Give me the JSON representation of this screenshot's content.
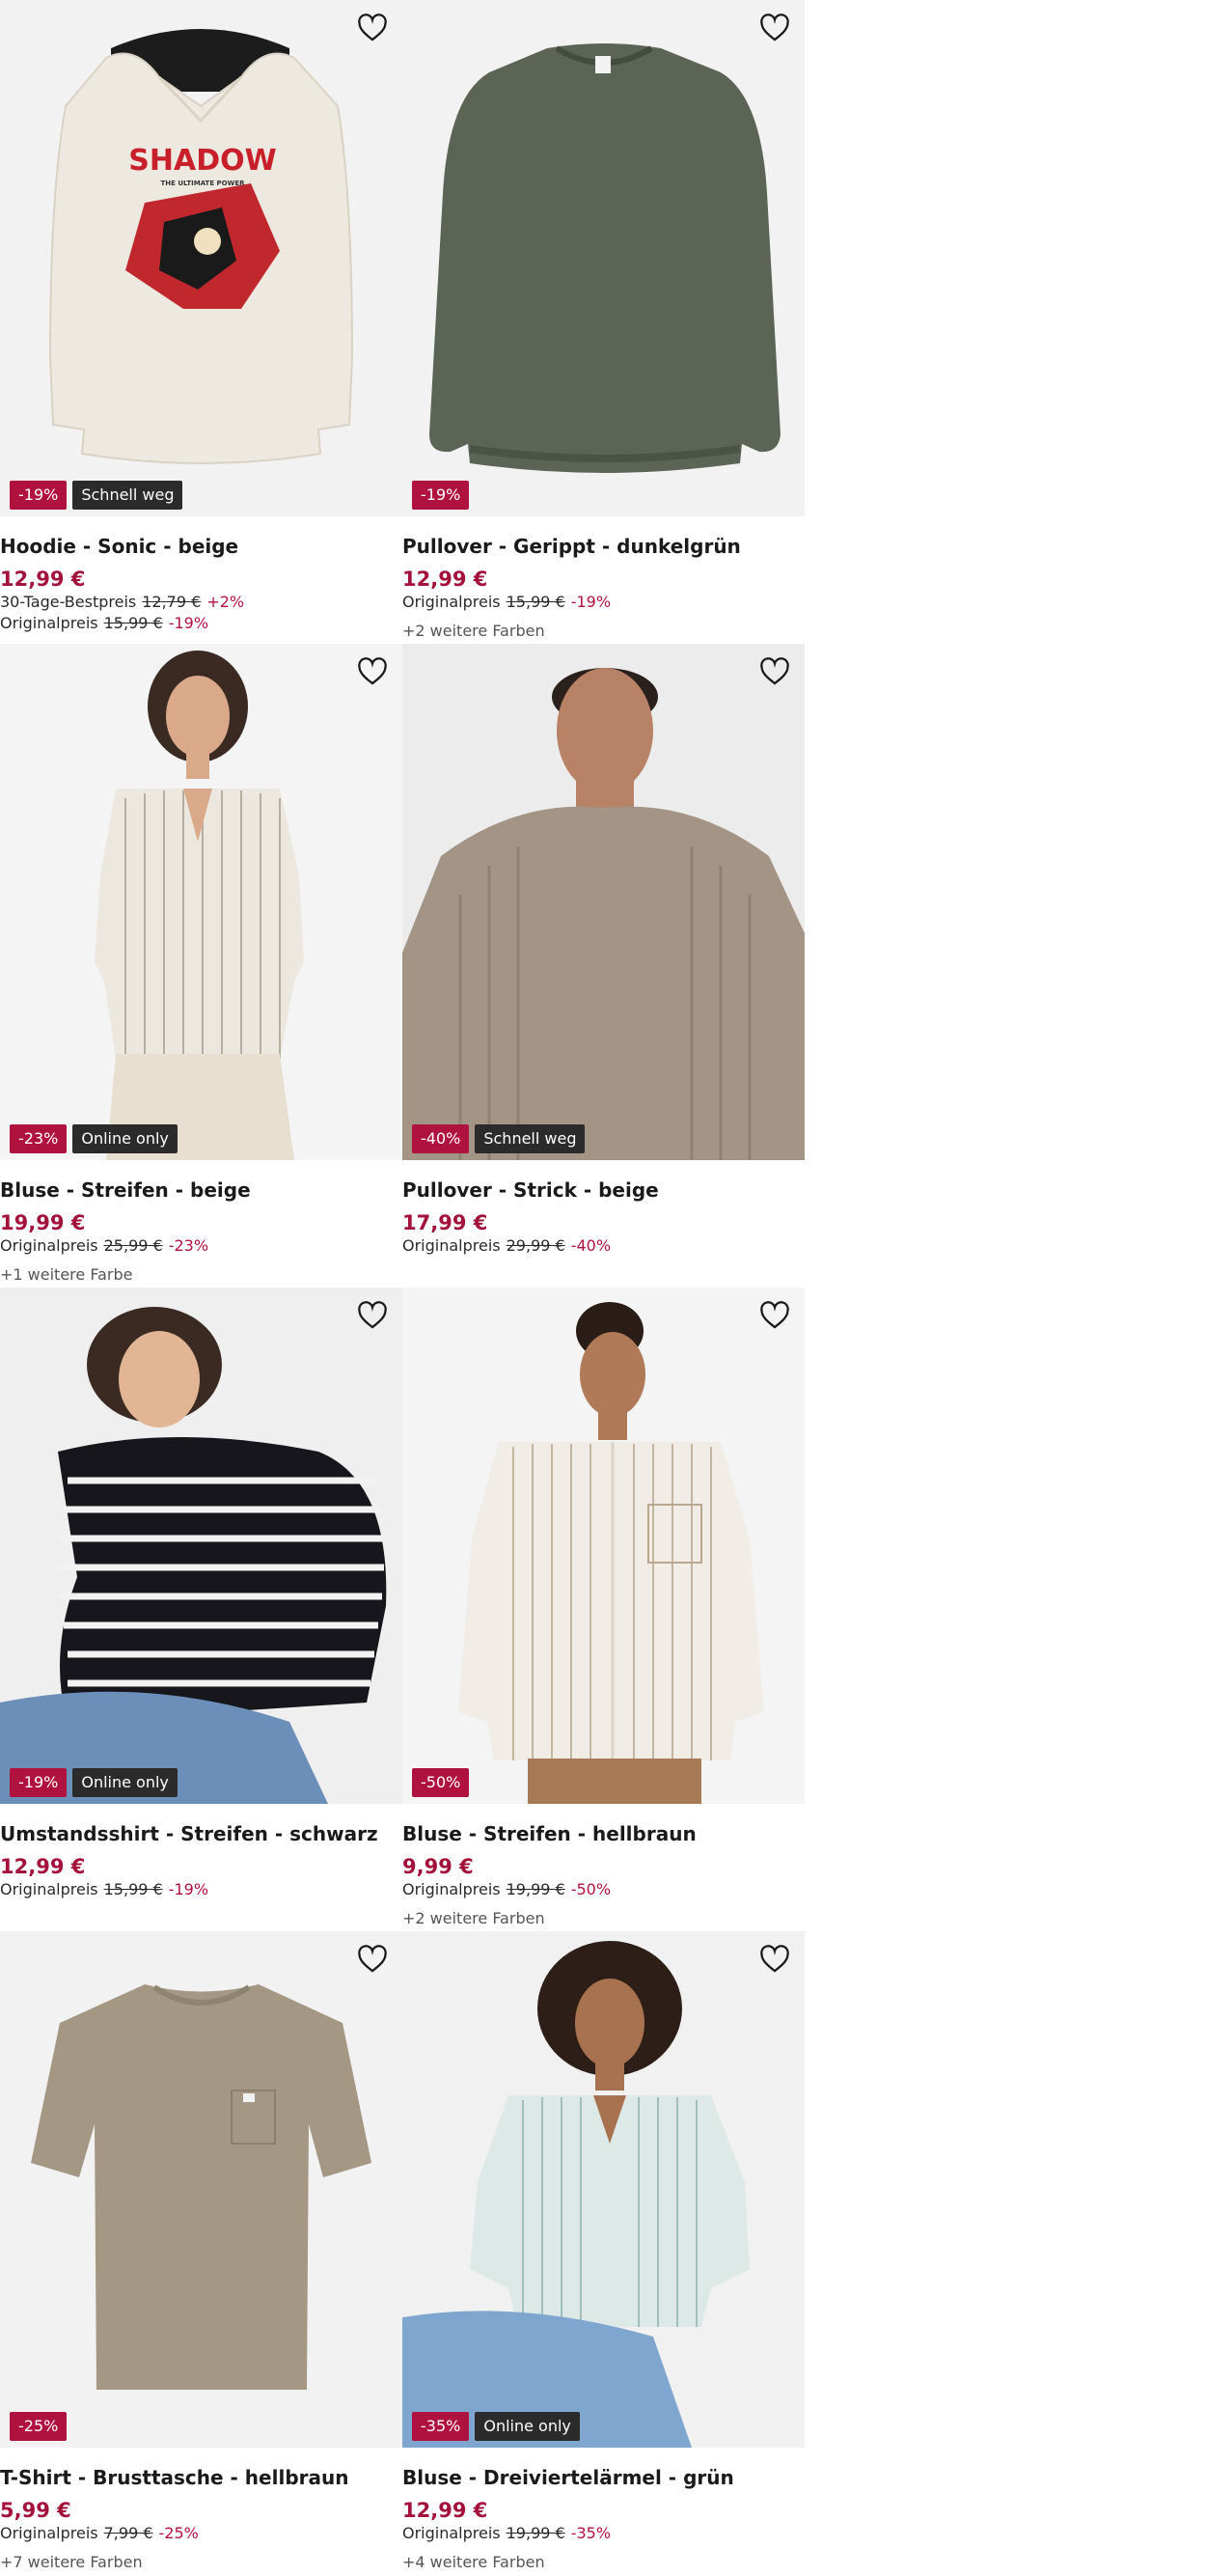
{
  "products": [
    {
      "name": "Hoodie - Sonic - beige",
      "price": "12,99 €",
      "badges": {
        "discount": "-19%",
        "tag": "Schnell weg"
      },
      "lowest30": {
        "label": "30-Tage-Bestpreis",
        "value": "12,79 €",
        "pct": "+2%"
      },
      "original": {
        "label": "Originalpreis",
        "value": "15,99 €",
        "pct": "-19%"
      },
      "colors": "",
      "print_title": "SHADOW",
      "print_sub": "THE ULTIMATE POWER",
      "garment_color": "#eee9e0"
    },
    {
      "name": "Pullover - Gerippt - dunkelgrün",
      "price": "12,99 €",
      "badges": {
        "discount": "-19%",
        "tag": ""
      },
      "original": {
        "label": "Originalpreis",
        "value": "15,99 €",
        "pct": "-19%"
      },
      "colors": "+2 weitere Farben",
      "garment_color": "#5b6455"
    },
    {
      "name": "Bluse - Streifen - beige",
      "price": "19,99 €",
      "badges": {
        "discount": "-23%",
        "tag": "Online only"
      },
      "original": {
        "label": "Originalpreis",
        "value": "25,99 €",
        "pct": "-23%"
      },
      "colors": "+1 weitere Farbe",
      "garment_color": "#ede8df"
    },
    {
      "name": "Pullover - Strick - beige",
      "price": "17,99 €",
      "badges": {
        "discount": "-40%",
        "tag": "Schnell weg"
      },
      "original": {
        "label": "Originalpreis",
        "value": "29,99 €",
        "pct": "-40%"
      },
      "colors": "",
      "garment_color": "#a39485"
    },
    {
      "name": "Umstandsshirt - Streifen - schwarz",
      "price": "12,99 €",
      "badges": {
        "discount": "-19%",
        "tag": "Online only"
      },
      "original": {
        "label": "Originalpreis",
        "value": "15,99 €",
        "pct": "-19%"
      },
      "colors": "",
      "garment_color": "#16161c"
    },
    {
      "name": "Bluse - Streifen - hellbraun",
      "price": "9,99 €",
      "badges": {
        "discount": "-50%",
        "tag": ""
      },
      "original": {
        "label": "Originalpreis",
        "value": "19,99 €",
        "pct": "-50%"
      },
      "colors": "+2 weitere Farben",
      "garment_color": "#f1ede6"
    },
    {
      "name": "T-Shirt - Brusttasche - hellbraun",
      "price": "5,99 €",
      "badges": {
        "discount": "-25%",
        "tag": ""
      },
      "original": {
        "label": "Originalpreis",
        "value": "7,99 €",
        "pct": "-25%"
      },
      "colors": "+7 weitere Farben",
      "garment_color": "#a49784"
    },
    {
      "name": "Bluse - Dreiviertelärmel - grün",
      "price": "12,99 €",
      "badges": {
        "discount": "-35%",
        "tag": "Online only"
      },
      "original": {
        "label": "Originalpreis",
        "value": "19,99 €",
        "pct": "-35%"
      },
      "colors": "+4 weitere Farben",
      "garment_color": "#dde9e6"
    }
  ],
  "icons": {
    "wishlist": "heart-outline-icon"
  },
  "colors": {
    "price": "#a3123a",
    "discount_badge": "#b0123f",
    "tag_badge": "#2b2b2b",
    "image_bg": "#f2f2f2"
  }
}
